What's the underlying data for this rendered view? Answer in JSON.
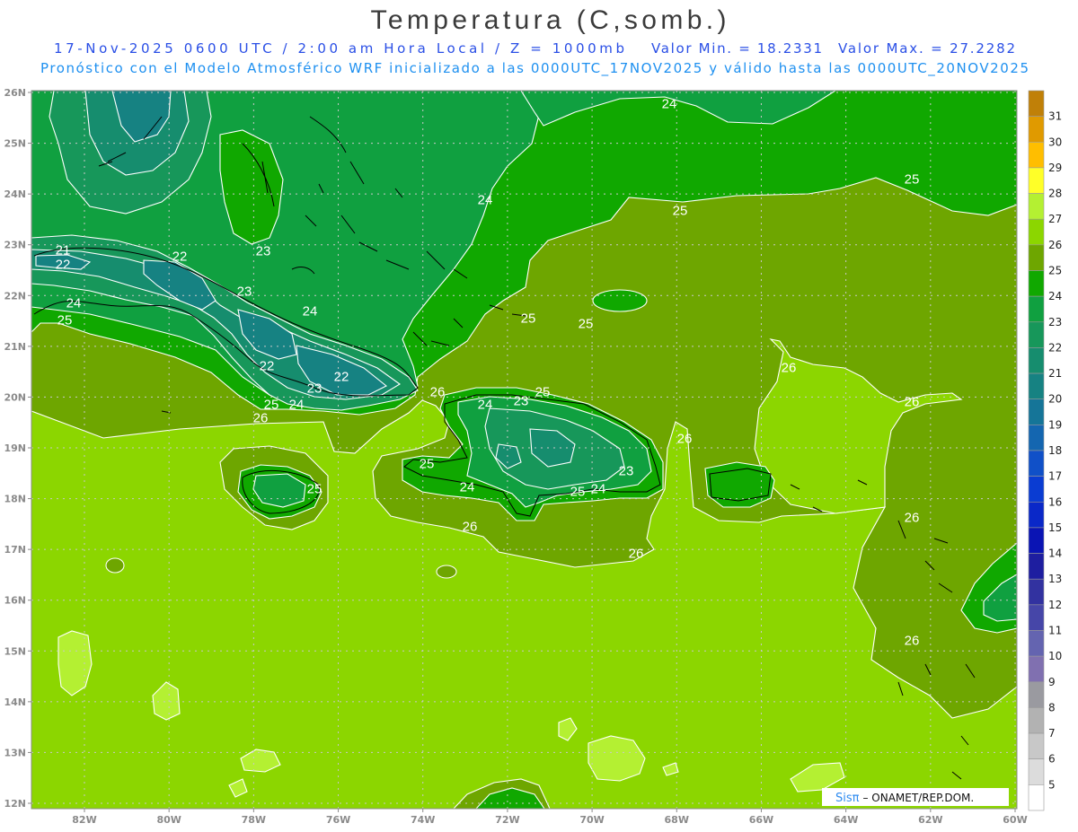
{
  "title": "Temperatura (C,somb.)",
  "subtitle": {
    "line1_left": "17-Nov-2025  0600 UTC / 2:00 am Hora Local / Z = 1000mb",
    "valor_min": "Valor Min. = 18.2331",
    "valor_max": "Valor Max. = 27.2282",
    "line2": "Pronóstico con el Modelo Atmosférico WRF inicializado a las 0000UTC_17NOV2025 y válido hasta las  0000UTC_20NOV2025"
  },
  "map": {
    "lat_labels": [
      "26N",
      "25N",
      "24N",
      "23N",
      "22N",
      "21N",
      "20N",
      "19N",
      "18N",
      "17N",
      "16N",
      "15N",
      "14N",
      "13N",
      "12N"
    ],
    "lon_labels": [
      "82W",
      "80W",
      "78W",
      "76W",
      "74W",
      "72W",
      "70W",
      "68W",
      "66W",
      "64W",
      "62W",
      "60W"
    ],
    "contour_labels": [
      "24",
      "25",
      "24",
      "25",
      "23",
      "21",
      "22",
      "22",
      "23",
      "24",
      "24",
      "25",
      "25",
      "25",
      "26",
      "22",
      "22",
      "23",
      "26",
      "25",
      "23",
      "24",
      "25",
      "24",
      "26",
      "26",
      "26",
      "25",
      "23",
      "25",
      "24",
      "25",
      "24",
      "26",
      "26",
      "26",
      "26"
    ]
  },
  "colorbar": {
    "ticks": [
      "31",
      "30",
      "29",
      "28",
      "27",
      "26",
      "25",
      "24",
      "23",
      "22",
      "21",
      "20",
      "19",
      "18",
      "17",
      "16",
      "15",
      "14",
      "13",
      "12",
      "11",
      "10",
      "9",
      "8",
      "7",
      "6",
      "5"
    ],
    "colors": [
      "#c08008",
      "#e09a00",
      "#ffbe00",
      "#ffff28",
      "#b4f032",
      "#8cd600",
      "#6ea600",
      "#10a800",
      "#10a040",
      "#17975a",
      "#168d6e",
      "#168282",
      "#157598",
      "#1466b0",
      "#1050c8",
      "#0a3cd2",
      "#0a28c8",
      "#0a14b4",
      "#1e1ea0",
      "#3232a0",
      "#4646a8",
      "#6464b0",
      "#8070b0",
      "#9a9aa0",
      "#b2b2b2",
      "#c8c8c8",
      "#dcdcdc",
      "#ffffff"
    ]
  },
  "credit": {
    "brand": "Sisπ",
    "org": " – ONAMET/REP.DOM."
  }
}
